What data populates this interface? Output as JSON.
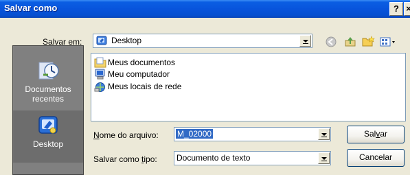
{
  "window": {
    "title": "Salvar como",
    "help_label": "?",
    "close_label": "×"
  },
  "location": {
    "label_prefix": "",
    "label_accel": "S",
    "label_rest": "alvar em:",
    "value": "Desktop"
  },
  "toolbar": {
    "back_icon": "back-arrow-icon",
    "up_icon": "up-folder-icon",
    "new_folder_icon": "new-folder-icon",
    "views_icon": "views-menu-icon"
  },
  "places": [
    {
      "label_line1": "Documentos",
      "label_line2": "recentes",
      "icon": "recent-documents-icon"
    },
    {
      "label_line1": "Desktop",
      "label_line2": "",
      "icon": "desktop-icon"
    }
  ],
  "files": [
    {
      "name": "Meus documentos",
      "icon": "my-documents-folder-icon"
    },
    {
      "name": "Meu computador",
      "icon": "my-computer-icon"
    },
    {
      "name": "Meus locais de rede",
      "icon": "network-places-icon"
    }
  ],
  "filename": {
    "label_accel": "N",
    "label_rest": "ome do arquivo:",
    "value": "M_02000"
  },
  "filetype": {
    "label_prefix": "Salvar como ",
    "label_accel": "t",
    "label_rest": "ipo:",
    "value": "Documento de texto"
  },
  "buttons": {
    "save_prefix": "Sal",
    "save_accel": "v",
    "save_rest": "ar",
    "cancel": "Cancelar"
  },
  "colors": {
    "titlebar": "#0854dc",
    "dialog_bg": "#ece9d8",
    "places_bg": "#808080",
    "selection": "#316ac5"
  }
}
